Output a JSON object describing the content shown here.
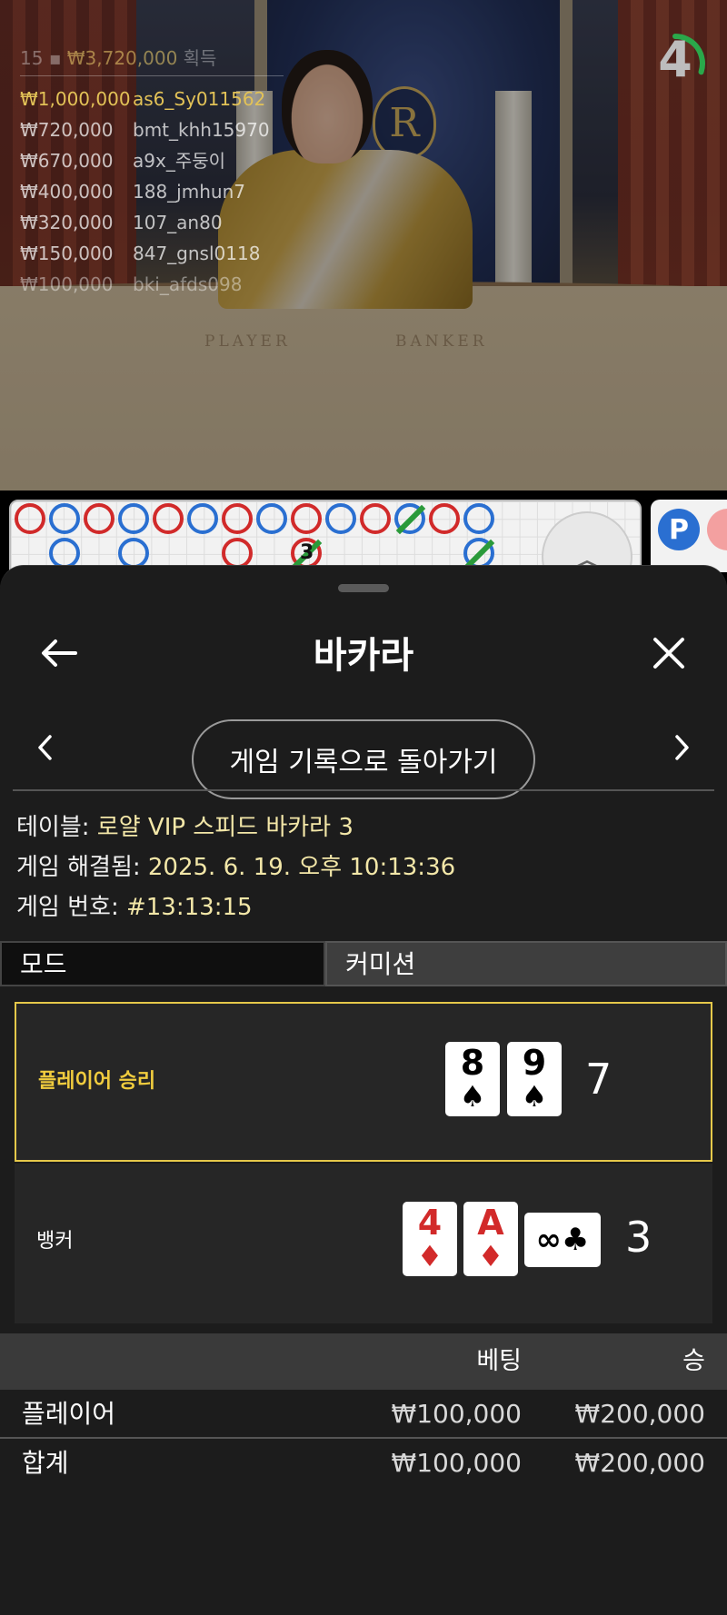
{
  "winners": {
    "header_count": "15",
    "header_amount": "₩3,720,000",
    "header_suffix": "획득",
    "rows": [
      {
        "amount": "₩1,000,000",
        "user": "as6_Sy011562"
      },
      {
        "amount": "₩720,000",
        "user": "bmt_khh15970"
      },
      {
        "amount": "₩670,000",
        "user": "a9x_주둥이"
      },
      {
        "amount": "₩400,000",
        "user": "188_jmhun7"
      },
      {
        "amount": "₩320,000",
        "user": "107_an80"
      },
      {
        "amount": "₩150,000",
        "user": "847_gnsl0118"
      },
      {
        "amount": "₩100,000",
        "user": "bki_afds098"
      }
    ]
  },
  "video": {
    "timer_value": "4",
    "timer_fraction": 0.3,
    "table_label_left": "PLAYER",
    "table_label_right": "BANKER",
    "crest_letter": "R"
  },
  "road": {
    "counter_label": "3",
    "side_button_label": "P",
    "expand_icon": "chevron-up-double-icon"
  },
  "colors": {
    "banker": "#d12a2a",
    "player": "#2a6fd1",
    "tie": "#2a9a3a",
    "highlight": "#e5c84a",
    "accent_text": "#f3e7a8",
    "timer": "#2aa84a"
  },
  "sheet": {
    "title": "바카라",
    "back_icon": "arrow-left-icon",
    "close_icon": "close-icon",
    "history_button": "게임 기록으로 돌아가기",
    "info": {
      "table_label": "테이블: ",
      "table_value": "로얄 VIP 스피드 바카라 3",
      "resolved_label": "게임 해결됨: ",
      "resolved_value": "2025. 6. 19. 오후 10:13:36",
      "number_label": "게임 번호: ",
      "number_value": "#13:13:15"
    },
    "mode_label": "모드",
    "mode_value": "커미션",
    "results": {
      "player": {
        "label": "플레이어 승리",
        "cards": [
          {
            "rank": "8",
            "suit": "♠"
          },
          {
            "rank": "9",
            "suit": "♠"
          }
        ],
        "score": "7"
      },
      "banker": {
        "label": "뱅커",
        "cards": [
          {
            "rank": "4",
            "suit": "♦"
          },
          {
            "rank": "A",
            "suit": "♦"
          }
        ],
        "third_card": {
          "rank": "∞",
          "suit": "♣"
        },
        "score": "3"
      }
    },
    "bets": {
      "col_bet": "베팅",
      "col_win": "승",
      "rows": [
        {
          "name": "플레이어",
          "bet": "₩100,000",
          "win": "₩200,000"
        },
        {
          "name": "합계",
          "bet": "₩100,000",
          "win": "₩200,000"
        }
      ]
    }
  }
}
